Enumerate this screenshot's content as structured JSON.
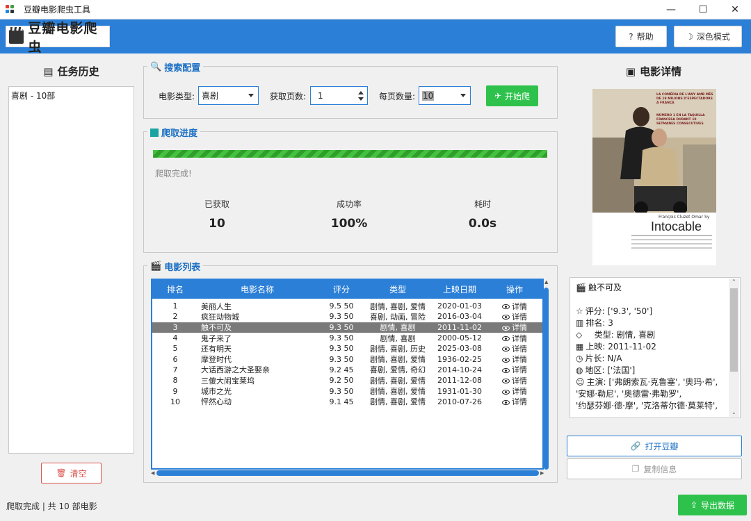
{
  "window": {
    "title": "豆瓣电影爬虫工具",
    "min": "—",
    "max": "☐",
    "close": "✕"
  },
  "header": {
    "logo": "豆瓣电影爬虫",
    "help": "帮助",
    "dark_mode": "深色模式"
  },
  "history": {
    "title": "任务历史",
    "items": [
      "喜剧 - 10部"
    ],
    "clear": "清空"
  },
  "search": {
    "title": "搜索配置",
    "type_label": "电影类型:",
    "type_value": "喜剧",
    "pages_label": "获取页数:",
    "pages_value": "1",
    "per_page_label": "每页数量:",
    "per_page_value": "10",
    "start": "开始爬"
  },
  "progress": {
    "title": "爬取进度",
    "percent": 100,
    "status": "爬取完成!",
    "fetched_label": "已获取",
    "fetched_value": "10",
    "success_label": "成功率",
    "success_value": "100%",
    "time_label": "耗时",
    "time_value": "0.0s"
  },
  "list": {
    "title": "电影列表",
    "headers": [
      "排名",
      "电影名称",
      "评分",
      "类型",
      "上映日期",
      "操作"
    ],
    "selected_index": 2,
    "rows": [
      [
        "1",
        "美丽人生",
        "9.5 50",
        "剧情, 喜剧, 爱情",
        "2020-01-03",
        "详情"
      ],
      [
        "2",
        "疯狂动物城",
        "9.3 50",
        "喜剧, 动画, 冒险",
        "2016-03-04",
        "详情"
      ],
      [
        "3",
        "触不可及",
        "9.3 50",
        "剧情, 喜剧",
        "2011-11-02",
        "详情"
      ],
      [
        "4",
        "鬼子来了",
        "9.3 50",
        "剧情, 喜剧",
        "2000-05-12",
        "详情"
      ],
      [
        "5",
        "还有明天",
        "9.3 50",
        "剧情, 喜剧, 历史",
        "2025-03-08",
        "详情"
      ],
      [
        "6",
        "摩登时代",
        "9.3 50",
        "剧情, 喜剧, 爱情",
        "1936-02-25",
        "详情"
      ],
      [
        "7",
        "大话西游之大圣娶亲",
        "9.2 45",
        "喜剧, 爱情, 奇幻",
        "2014-10-24",
        "详情"
      ],
      [
        "8",
        "三傻大闹宝莱坞",
        "9.2 50",
        "剧情, 喜剧, 爱情",
        "2011-12-08",
        "详情"
      ],
      [
        "9",
        "城市之光",
        "9.3 50",
        "剧情, 喜剧, 爱情",
        "1931-01-30",
        "详情"
      ],
      [
        "10",
        "怦然心动",
        "9.1 45",
        "剧情, 喜剧, 爱情",
        "2010-07-26",
        "详情"
      ]
    ]
  },
  "detail": {
    "title": "电影详情",
    "poster": {
      "cast_line": "François Cluzet   Omar Sy",
      "movie_title": "Intocable",
      "tagline": "LA COMÉDIA DE L'ANY AMB MÉS DE 19 MILIONS D'ESPECTADORS A FRANÇA",
      "tagline2": "NÚMERO 1 EN LA TAQUILLA FRANCESA DURANT 10 SETMANES CONSECUTIVES"
    },
    "name": "触不可及",
    "rating": "评分: ['9.3', '50']",
    "rank": "排名: 3",
    "genre": "类型: 剧情, 喜剧",
    "release": "上映: 2011-11-02",
    "runtime": "片长: N/A",
    "region": "地区: ['法国']",
    "cast_1": "主演: ['弗朗索瓦·克鲁塞', '奥玛·希',",
    "cast_2": "'安娜·勒尼', '奥德雷·弗勒罗',",
    "cast_3": "'约瑟芬娜·德·摩', '克洛蒂尔德·莫莱特',",
    "open": "打开豆瓣",
    "copy": "复制信息"
  },
  "footer": {
    "status": "爬取完成 | 共 10 部电影",
    "export": "导出数据"
  },
  "colors": {
    "accent": "#2b7fd7",
    "green": "#2ec24c",
    "danger": "#d9534f"
  }
}
